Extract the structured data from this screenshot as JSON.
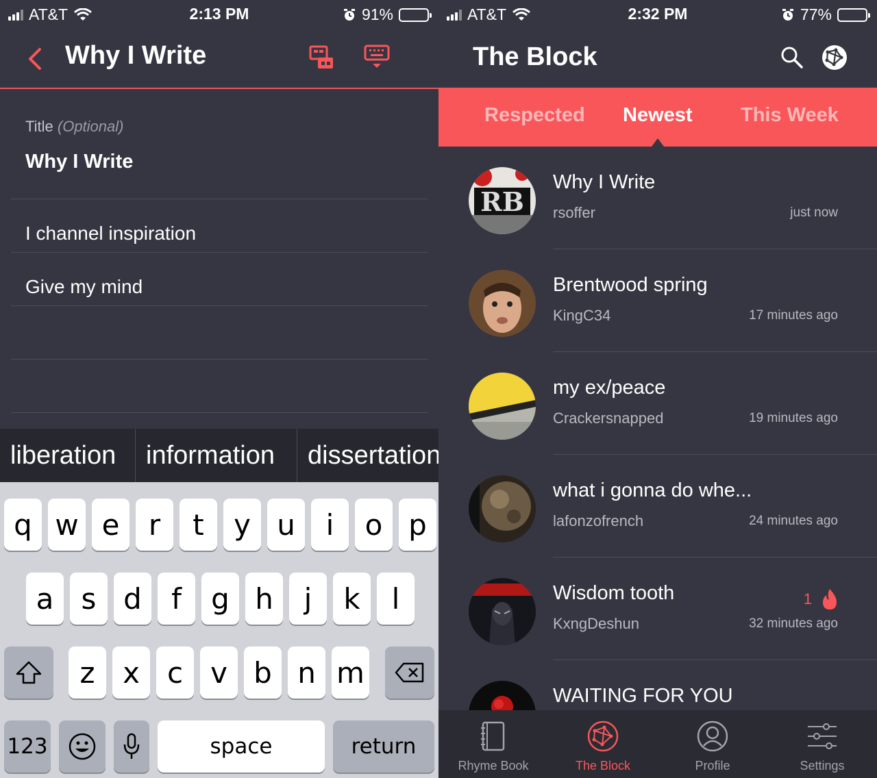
{
  "left": {
    "status": {
      "carrier": "AT&T",
      "time": "2:13 PM",
      "battery": "91%",
      "battery_level": 0.91
    },
    "nav": {
      "title": "Why I Write"
    },
    "form": {
      "title_label": "Title",
      "title_optional": "(Optional)",
      "title_value": "Why I Write",
      "lines": [
        "I channel inspiration",
        "Give my mind"
      ]
    },
    "suggestions": [
      "liberation",
      "information",
      "dissertation"
    ],
    "keyboard": {
      "row1": [
        "q",
        "w",
        "e",
        "r",
        "t",
        "y",
        "u",
        "i",
        "o",
        "p"
      ],
      "row2": [
        "a",
        "s",
        "d",
        "f",
        "g",
        "h",
        "j",
        "k",
        "l"
      ],
      "row3": [
        "z",
        "x",
        "c",
        "v",
        "b",
        "n",
        "m"
      ],
      "numbers_label": "123",
      "space_label": "space",
      "return_label": "return"
    }
  },
  "right": {
    "status": {
      "carrier": "AT&T",
      "time": "2:32 PM",
      "battery": "77%",
      "battery_level": 0.77
    },
    "nav": {
      "title": "The Block"
    },
    "tabs": [
      "Respected",
      "Newest",
      "This Week"
    ],
    "active_tab": "Newest",
    "feed": [
      {
        "title": "Why I Write",
        "user": "rsoffer",
        "time": "just now"
      },
      {
        "title": "Brentwood spring",
        "user": "KingC34",
        "time": "17 minutes ago"
      },
      {
        "title": "my ex/peace",
        "user": "Crackersnapped",
        "time": "19 minutes ago"
      },
      {
        "title": "what i gonna do whe...",
        "user": "lafonzofrench",
        "time": "24 minutes ago"
      },
      {
        "title": "Wisdom tooth",
        "user": "KxngDeshun",
        "time": "32 minutes ago",
        "fire_count": "1"
      },
      {
        "title": "WAITING FOR YOU",
        "user": "",
        "time": ""
      }
    ],
    "tabbar": [
      {
        "label": "Rhyme Book",
        "icon": "notebook-icon"
      },
      {
        "label": "The Block",
        "icon": "globe-network-icon"
      },
      {
        "label": "Profile",
        "icon": "profile-icon"
      },
      {
        "label": "Settings",
        "icon": "sliders-icon"
      }
    ],
    "active_tabbar": "The Block"
  },
  "colors": {
    "accent": "#f9565a",
    "background": "#363642",
    "tabbar": "#2b2b34"
  }
}
